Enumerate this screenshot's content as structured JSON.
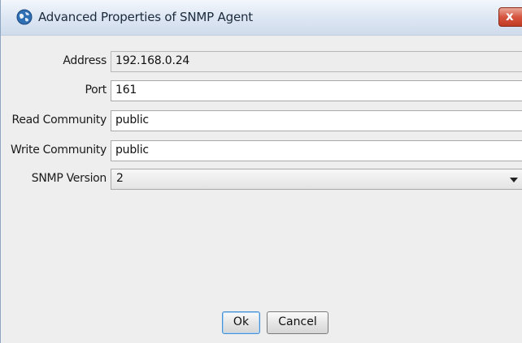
{
  "window": {
    "title": "Advanced Properties of SNMP Agent",
    "title_icon": "globe-network-icon",
    "close_glyph": "x",
    "close_icon": "close-icon"
  },
  "form": {
    "address": {
      "label": "Address",
      "value": "192.168.0.24",
      "readonly": true
    },
    "port": {
      "label": "Port",
      "value": "161"
    },
    "read_community": {
      "label": "Read Community",
      "value": "public"
    },
    "write_community": {
      "label": "Write Community",
      "value": "public"
    },
    "snmp_version": {
      "label": "SNMP Version",
      "selected": "2",
      "dropdown_icon": "chevron-down-icon"
    }
  },
  "buttons": {
    "ok": "Ok",
    "cancel": "Cancel"
  },
  "colors": {
    "title_gradient_top": "#f3f7fc",
    "title_gradient_bottom": "#cfdbec",
    "close_button": "#d7553f",
    "dialog_background": "#eeeeee",
    "default_button_border": "#4a8fd0"
  }
}
